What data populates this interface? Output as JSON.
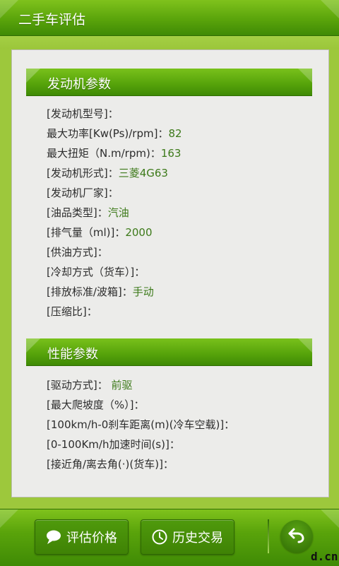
{
  "titlebar": {
    "title": "二手车评估"
  },
  "sections": {
    "engine": {
      "title": "发动机参数",
      "rows": [
        {
          "label": "[发动机型号]：",
          "value": ""
        },
        {
          "label": "最大功率[Kw(Ps)/rpm]：",
          "value": "82"
        },
        {
          "label": "最大扭矩（N.m/rpm)：",
          "value": "163"
        },
        {
          "label": "[发动机形式]：",
          "value": "三菱4G63"
        },
        {
          "label": "[发动机厂家]：",
          "value": ""
        },
        {
          "label": "[油品类型]：",
          "value": "汽油"
        },
        {
          "label": "[排气量（ml)]：",
          "value": "2000"
        },
        {
          "label": "[供油方式]：",
          "value": ""
        },
        {
          "label": "[冷却方式（货车）]：",
          "value": ""
        },
        {
          "label": "[排放标准/波箱]：",
          "value": "手动"
        },
        {
          "label": "[压缩比]：",
          "value": ""
        }
      ]
    },
    "performance": {
      "title": "性能参数",
      "rows": [
        {
          "label": "[驱动方式]： ",
          "value": "前驱"
        },
        {
          "label": "[最大爬坡度（%）]：",
          "value": ""
        },
        {
          "label": "[100km/h-0刹车距离(m)(冷车空载)]：",
          "value": ""
        },
        {
          "label": "[0-100Km/h加速时间(s)]：",
          "value": ""
        },
        {
          "label": "[接近角/离去角(·)(货车)]：",
          "value": ""
        }
      ]
    }
  },
  "toolbar": {
    "evaluate_label": "评估价格",
    "history_label": "历史交易",
    "evaluate_icon": "chat-bubble-icon",
    "history_icon": "clock-icon",
    "back_icon": "back-arrow-icon"
  },
  "watermark": "d.cn",
  "colors": {
    "accent_green": "#5aa40b",
    "value_green": "#3d7a1a",
    "panel_bg": "#ececea"
  }
}
